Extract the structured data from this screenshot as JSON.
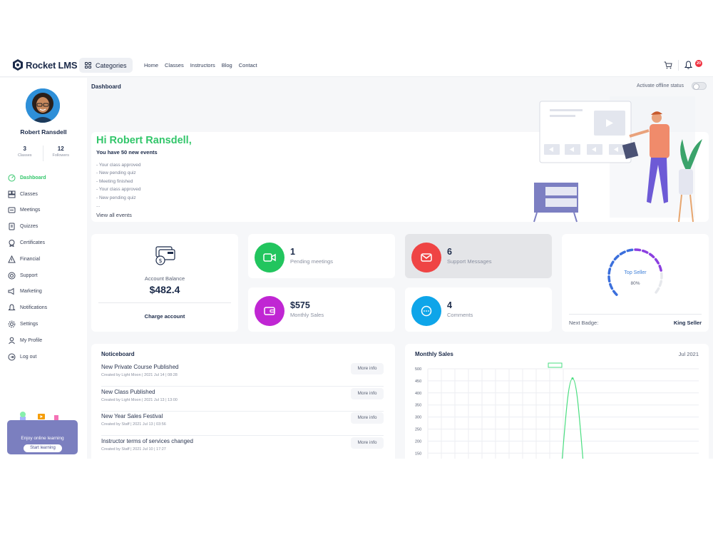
{
  "app": {
    "logo_text": "Rocket LMS"
  },
  "header": {
    "categories_label": "Categories",
    "nav": [
      "Home",
      "Classes",
      "Instructors",
      "Blog",
      "Contact"
    ],
    "notification_count": "20"
  },
  "sidebar": {
    "user_name": "Robert Ransdell",
    "stats": [
      {
        "value": "3",
        "label": "Classes"
      },
      {
        "value": "12",
        "label": "Followers"
      }
    ],
    "menu": [
      {
        "label": "Dashboard",
        "icon": "dashboard-icon",
        "active": true
      },
      {
        "label": "Classes",
        "icon": "classes-icon"
      },
      {
        "label": "Meetings",
        "icon": "meetings-icon"
      },
      {
        "label": "Quizzes",
        "icon": "quizzes-icon"
      },
      {
        "label": "Certificates",
        "icon": "certificate-icon"
      },
      {
        "label": "Financial",
        "icon": "financial-icon"
      },
      {
        "label": "Support",
        "icon": "support-icon"
      },
      {
        "label": "Marketing",
        "icon": "marketing-icon"
      },
      {
        "label": "Notifications",
        "icon": "bell-icon"
      },
      {
        "label": "Settings",
        "icon": "gear-icon"
      },
      {
        "label": "My Profile",
        "icon": "user-icon"
      },
      {
        "label": "Log out",
        "icon": "logout-icon"
      }
    ],
    "promo": {
      "text": "Enjoy online learning",
      "button": "Start learning"
    }
  },
  "page": {
    "title": "Dashboard",
    "offline_label": "Activate offline status"
  },
  "hero": {
    "greeting": "Hi Robert Ransdell,",
    "subtitle": "You have 50 new events",
    "events": [
      "- Your class approved",
      "- New pending quiz",
      "- Meeting finished",
      "- Your class approved",
      "- New pending quiz",
      "..."
    ],
    "view_all": "View all events"
  },
  "balance": {
    "label": "Account Balance",
    "value": "$482.4",
    "charge_label": "Charge account"
  },
  "stat_cards": [
    {
      "value": "1",
      "label": "Pending meetings",
      "icon": "video-icon",
      "color": "#22c55e"
    },
    {
      "value": "6",
      "label": "Support Messages",
      "icon": "mail-icon",
      "color": "#ef4444"
    },
    {
      "value": "$575",
      "label": "Monthly Sales",
      "icon": "wallet-icon",
      "color": "#c026d3"
    },
    {
      "value": "4",
      "label": "Comments",
      "icon": "chat-icon",
      "color": "#0ea5e9"
    }
  ],
  "badge": {
    "title": "Top Seller",
    "progress": 80,
    "progress_label": "80%",
    "next_label": "Next Badge:",
    "next_value": "King Seller"
  },
  "noticeboard": {
    "title": "Noticeboard",
    "more_label": "More info",
    "items": [
      {
        "title": "New Private Course Published",
        "meta": "Created by Light Moon  |  2021 Jul 14 | 08:28"
      },
      {
        "title": "New Class Published",
        "meta": "Created by Light Moon  |  2021 Jul 13 | 13:00"
      },
      {
        "title": "New Year Sales Festival",
        "meta": "Created by Staff  |  2021 Jul 13 | 03:56"
      },
      {
        "title": "Instructor terms of services changed",
        "meta": "Created by Staff  |  2021 Jul 10 | 17:27"
      }
    ]
  },
  "chart_data": {
    "type": "line",
    "title": "Monthly Sales",
    "period": "Jul 2021",
    "xlabel": "",
    "ylabel": "",
    "yticks": [
      500,
      450,
      400,
      350,
      300,
      250,
      200,
      150
    ],
    "ylim": [
      150,
      500
    ],
    "grid": true,
    "series": [
      {
        "color": "#4ade80",
        "points": [
          [
            0,
            0
          ],
          [
            1,
            460
          ],
          [
            2,
            0
          ]
        ]
      }
    ]
  }
}
